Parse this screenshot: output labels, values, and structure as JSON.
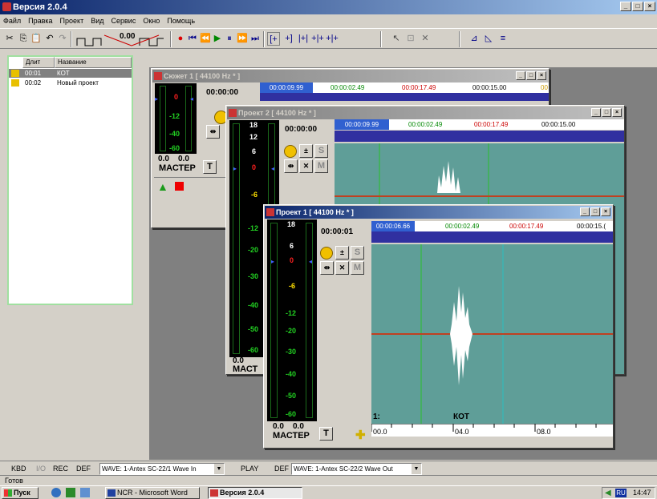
{
  "app": {
    "title": "Версия 2.0.4"
  },
  "menu": [
    "Файл",
    "Правка",
    "Проект",
    "Вид",
    "Сервис",
    "Окно",
    "Помощь"
  ],
  "toolbar": {
    "counter": "0.00"
  },
  "list": {
    "headers": [
      "Длит",
      "Название"
    ],
    "rows": [
      {
        "dur": "00:01",
        "name": "КОТ"
      },
      {
        "dur": "00:02",
        "name": "Новый проект"
      }
    ]
  },
  "win_sujet": {
    "title": "Сюжет 1 [ 44100 Hz * ]",
    "time": "00:00:00",
    "master": "МАСТЕР",
    "lvl_left": "0.0",
    "lvl_right": "0.0",
    "scale": [
      "0",
      "-12",
      "-40",
      "-60"
    ],
    "ticks": [
      "00:00:09.99",
      "00:00:02.49",
      "00:00:17.49",
      "00:00:15.00",
      "00"
    ]
  },
  "win_p2": {
    "title": "Проект 2 [ 44100 Hz * ]",
    "time": "00:00:00",
    "master": "МАСТ",
    "lvl_left": "0.0",
    "scale": [
      "18",
      "12",
      "6",
      "0",
      "-6",
      "-12",
      "-20",
      "-30",
      "-40",
      "-50",
      "-60"
    ],
    "ticks": [
      "00:00:09.99",
      "00:00:02.49",
      "00:00:17.49",
      "00:00:15.00"
    ],
    "solo": "S",
    "mute": "M"
  },
  "win_p1": {
    "title": "Проект 1 [ 44100 Hz * ]",
    "time": "00:00:01",
    "master": "МАСТЕР",
    "lvl_left": "0.0",
    "lvl_right": "0.0",
    "scale": [
      "18",
      "6",
      "0",
      "-6",
      "-12",
      "-20",
      "-30",
      "-40",
      "-50",
      "-60"
    ],
    "ticks": [
      "00:00:06.66",
      "00:00:02.49",
      "00:00:17.49",
      "00:00:15.("
    ],
    "solo": "S",
    "mute": "M",
    "track_num": "1:",
    "clip_name": "КОТ",
    "ruler": [
      "00.0",
      "04.0",
      "08.0"
    ]
  },
  "status": {
    "kbd": "KBD",
    "io": "I/O",
    "rec": "REC",
    "def1": "DEF",
    "wave_in": "WAVE: 1-Antex SC-22/1 Wave In",
    "play": "PLAY",
    "def2": "DEF",
    "wave_out": "WAVE: 1-Antex SC-22/2 Wave Out",
    "ready": "Готов"
  },
  "taskbar": {
    "start": "Пуск",
    "tasks": [
      "NCR - Microsoft Word",
      "Версия 2.0.4"
    ],
    "lang": "RU",
    "clock": "14:47"
  },
  "colors": {
    "meter_green": "#22d022",
    "meter_red": "#ff2020",
    "meter_yellow": "#ffe000",
    "wave_bg": "#5f9e98",
    "timeline_blue": "#3030a0"
  }
}
